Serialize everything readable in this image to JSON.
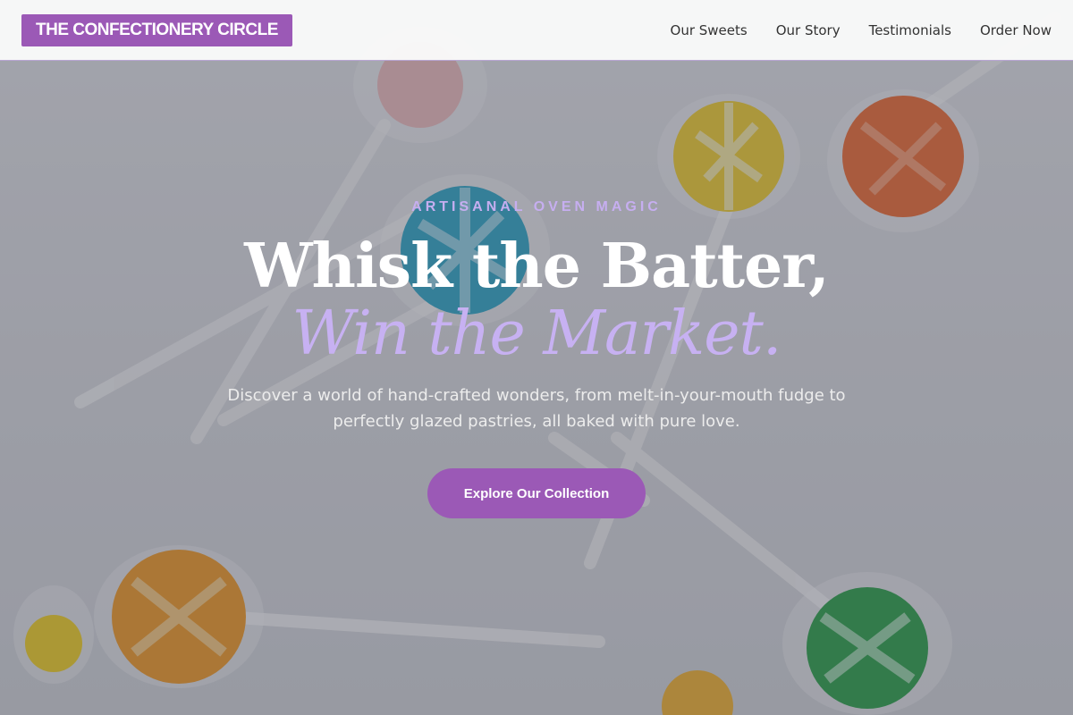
{
  "brand": {
    "logo_text": "THE CONFECTIONERY CIRCLE",
    "accent_color": "#9b59b6",
    "highlight_color": "#c7b1f2"
  },
  "nav": {
    "items": [
      {
        "label": "Our Sweets"
      },
      {
        "label": "Our Story"
      },
      {
        "label": "Testimonials"
      },
      {
        "label": "Order Now"
      }
    ]
  },
  "hero": {
    "eyebrow": "ARTISANAL OVEN MAGIC",
    "headline_line1": "Whisk the Batter,",
    "headline_line2": "Win the Market.",
    "description": "Discover a world of hand-crafted wonders, from melt-in-your-mouth fudge to perfectly glazed pastries, all baked with pure love.",
    "cta_label": "Explore Our Collection",
    "background_image": "lollipop-candies-photo"
  }
}
